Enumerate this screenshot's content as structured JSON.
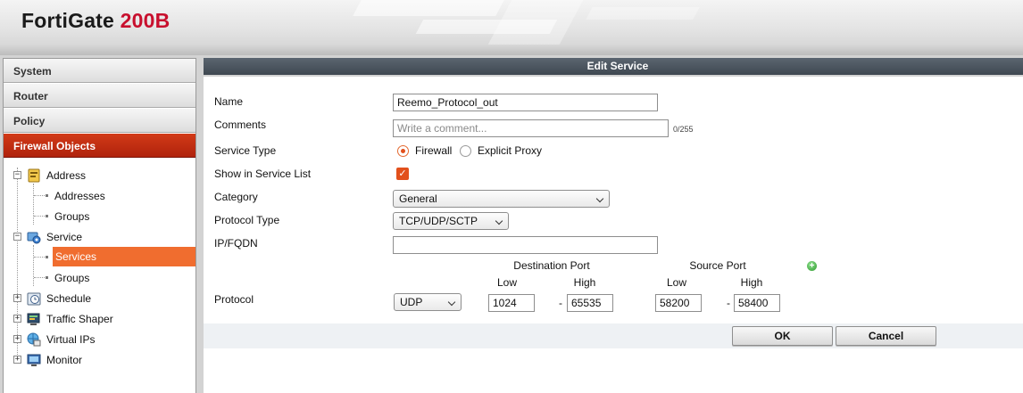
{
  "header": {
    "brand": "FortiGate",
    "model": "200B"
  },
  "sidebar": {
    "menu": [
      "System",
      "Router",
      "Policy",
      "Firewall Objects"
    ],
    "active_menu": "Firewall Objects",
    "tree": {
      "address": {
        "label": "Address",
        "children": [
          "Addresses",
          "Groups"
        ]
      },
      "service": {
        "label": "Service",
        "children": [
          "Services",
          "Groups"
        ],
        "selected": "Services"
      },
      "schedule": {
        "label": "Schedule"
      },
      "traffic_shaper": {
        "label": "Traffic Shaper"
      },
      "virtual_ips": {
        "label": "Virtual IPs"
      },
      "monitor": {
        "label": "Monitor"
      }
    }
  },
  "main": {
    "title": "Edit Service",
    "form": {
      "name_label": "Name",
      "name_value": "Reemo_Protocol_out",
      "comments_label": "Comments",
      "comments_placeholder": "Write a comment...",
      "comments_counter": "0/255",
      "service_type_label": "Service Type",
      "service_type_options": [
        "Firewall",
        "Explicit Proxy"
      ],
      "service_type_selected": "Firewall",
      "show_in_list_label": "Show in Service List",
      "show_in_list_checked": true,
      "category_label": "Category",
      "category_value": "General",
      "protocol_type_label": "Protocol Type",
      "protocol_type_value": "TCP/UDP/SCTP",
      "ipfqdn_label": "IP/FQDN",
      "ipfqdn_value": "",
      "protocol_label": "Protocol",
      "dest_port_header": "Destination Port",
      "source_port_header": "Source Port",
      "low_header": "Low",
      "high_header": "High",
      "protocol_value": "UDP",
      "dest_low": "1024",
      "dest_high": "65535",
      "src_low": "58200",
      "src_high": "58400",
      "dash": "-"
    },
    "buttons": {
      "ok": "OK",
      "cancel": "Cancel"
    }
  },
  "colors": {
    "accent": "#e2501c",
    "active_menu": "#c0300f",
    "title_bar": "#4a535c",
    "selection": "#f06d2f"
  }
}
